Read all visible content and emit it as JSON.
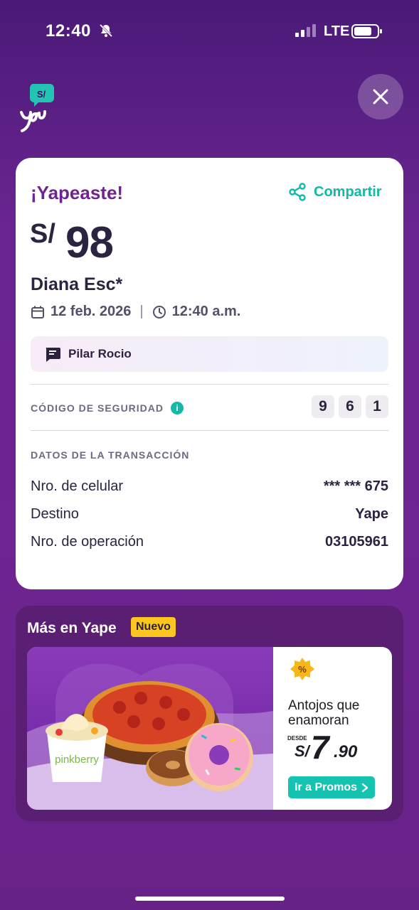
{
  "status_bar": {
    "time": "12:40",
    "network": "LTE"
  },
  "header": {
    "logo_text": "S/"
  },
  "receipt": {
    "title": "¡Yapeaste!",
    "share_label": "Compartir",
    "currency": "S/",
    "amount": "98",
    "recipient": "Diana Esc*",
    "date": "12 feb. 2026",
    "time": "12:40 a.m.",
    "note": "Pilar Rocio",
    "security_label": "CÓDIGO DE SEGURIDAD",
    "security_digits": [
      "9",
      "6",
      "1"
    ],
    "transaction_title": "DATOS DE LA TRANSACCIÓN",
    "rows": [
      {
        "label": "Nro. de celular",
        "value": "*** *** 675"
      },
      {
        "label": "Destino",
        "value": "Yape"
      },
      {
        "label": "Nro. de operación",
        "value": "03105961"
      }
    ]
  },
  "promo": {
    "section_title": "Más en Yape",
    "badge": "Nuevo",
    "headline": "Antojos que enamoran",
    "desde": "DESDE",
    "price_currency": "S/",
    "price_int": "7",
    "price_dec": ".90",
    "cta": "Ir a Promos",
    "brand": "pinkberry"
  },
  "colors": {
    "purple": "#6e2491",
    "teal": "#14b8a6",
    "yellow": "#fcc520"
  }
}
